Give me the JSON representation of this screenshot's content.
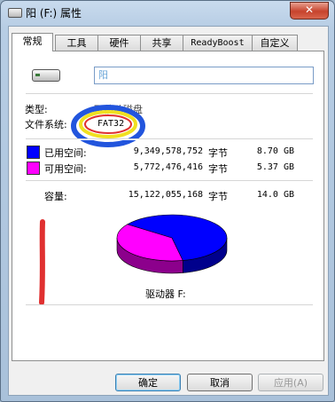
{
  "window": {
    "title": "阳 (F:) 属性",
    "close_label": "✕"
  },
  "tabs": [
    {
      "label": "常规"
    },
    {
      "label": "工具"
    },
    {
      "label": "硬件"
    },
    {
      "label": "共享"
    },
    {
      "label": "ReadyBoost"
    },
    {
      "label": "自定义"
    }
  ],
  "general": {
    "drive_name": "阳",
    "type_label": "类型:",
    "type_value": "可移动磁盘",
    "fs_label": "文件系统:",
    "fs_value": "FAT32",
    "used": {
      "label": "已用空间:",
      "bytes": "9,349,578,752",
      "unit": "字节",
      "size": "8.70 GB",
      "color": "#0000ff"
    },
    "free": {
      "label": "可用空间:",
      "bytes": "5,772,476,416",
      "unit": "字节",
      "size": "5.37 GB",
      "color": "#ff00ff"
    },
    "capacity": {
      "label": "容量:",
      "bytes": "15,122,055,168",
      "unit": "字节",
      "size": "14.0 GB"
    },
    "drive_caption": "驱动器 F:"
  },
  "buttons": {
    "ok": "确定",
    "cancel": "取消",
    "apply": "应用(A)"
  },
  "annotations": {
    "circle_color": "#2255dd",
    "inner_color": "#f0e020",
    "stroke_color": "#e03030"
  }
}
